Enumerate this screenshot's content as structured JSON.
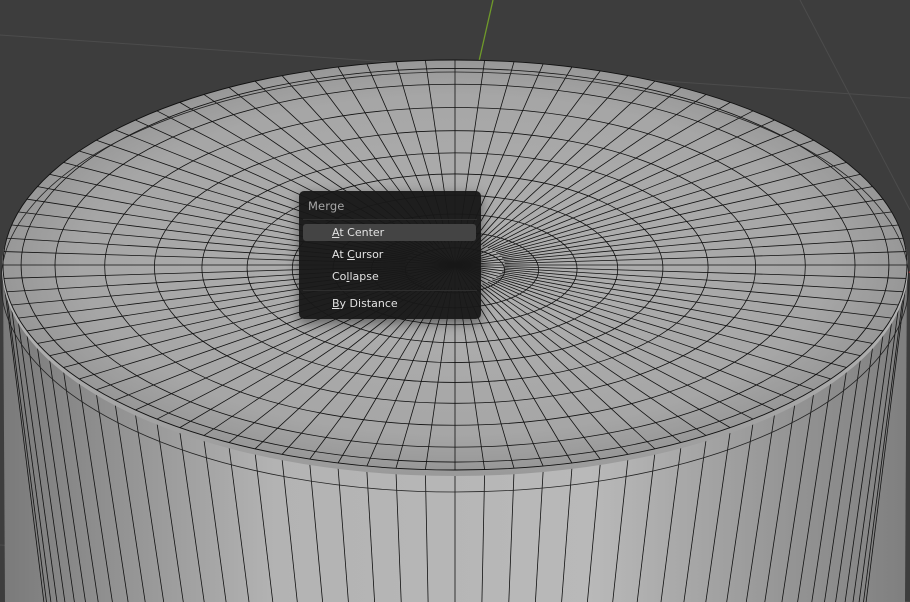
{
  "menu": {
    "title": "Merge",
    "items": [
      {
        "pre": "",
        "key": "A",
        "post": "t Center",
        "active": true
      },
      {
        "pre": "At ",
        "key": "C",
        "post": "ursor",
        "active": false
      },
      {
        "pre": "Co",
        "key": "l",
        "post": "lapse",
        "active": false
      },
      {
        "pre": "",
        "key": "B",
        "post": "y Distance",
        "active": false
      }
    ]
  },
  "colors": {
    "background": "#3d3d3d",
    "mesh_fill": "#a9a9a9",
    "wire": "#000000",
    "y_axis": "#6f9a2a",
    "x_axis": "#b6383a",
    "menu_bg": "#181818",
    "menu_highlight": "#444444"
  }
}
